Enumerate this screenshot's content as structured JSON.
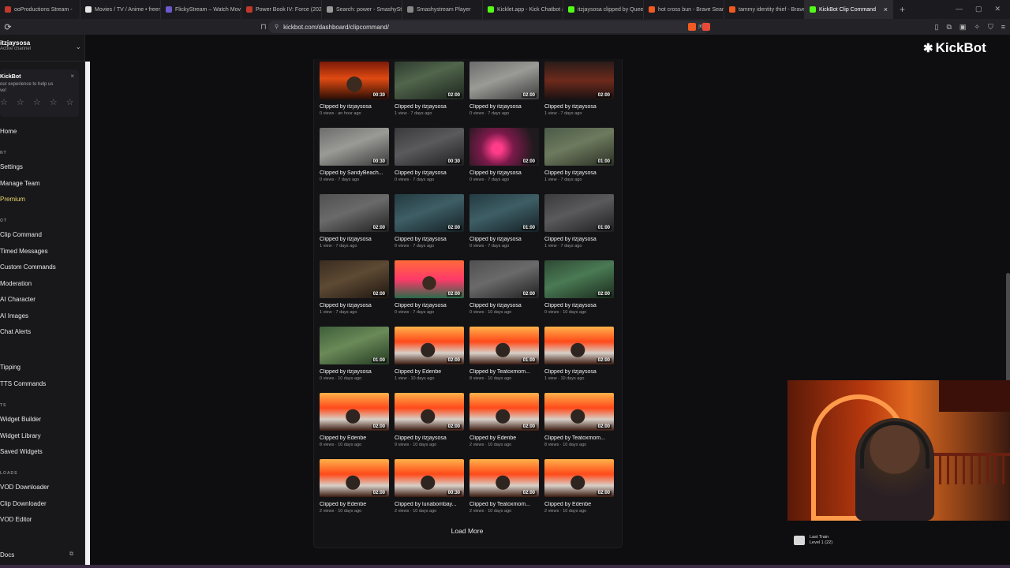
{
  "browser": {
    "tabs": [
      {
        "label": "ooProductions Stream - ",
        "fav": "#c0392b"
      },
      {
        "label": "Movies / TV / Anime • freemo...",
        "fav": "#e6e6e6"
      },
      {
        "label": "FlickyStream – Watch Movies &",
        "fav": "#6a5acd"
      },
      {
        "label": "Power Book IV: Force (2022) S...",
        "fav": "#c0392b"
      },
      {
        "label": "Search: power - SmashyStream",
        "fav": "#999999"
      },
      {
        "label": "Smashystream Player",
        "fav": "#888888"
      },
      {
        "label": "Kicklet.app - Kick Chatbot and",
        "fav": "#53fc18"
      },
      {
        "label": "itzjaysosa clipped by QueenH...",
        "fav": "#53fc18"
      },
      {
        "label": "hot cross bun - Brave Search",
        "fav": "#f15a22"
      },
      {
        "label": "tammy identity thief - Brave Se...",
        "fav": "#f15a22"
      },
      {
        "label": "KickBot Clip Command",
        "fav": "#53fc18",
        "active": true
      }
    ],
    "url": "kickbot.com/dashboard/clipcommand/"
  },
  "sidebar": {
    "channel_name": "itzjaysosa",
    "channel_status": "Active channel",
    "promo": {
      "title": "KickBot",
      "text_line1": "our experience to help us",
      "text_line2": "ve!",
      "stars": "☆ ☆ ☆ ☆ ☆",
      "close": "×"
    },
    "items": [
      {
        "label": "Home"
      },
      {
        "section": "NT"
      },
      {
        "label": "Settings"
      },
      {
        "label": "Manage Team"
      },
      {
        "label": "Premium"
      },
      {
        "section": "OT"
      },
      {
        "label": "Clip Command"
      },
      {
        "label": "Timed Messages"
      },
      {
        "label": "Custom Commands"
      },
      {
        "label": "Moderation"
      },
      {
        "label": "AI Character"
      },
      {
        "label": "AI Images"
      },
      {
        "label": "Chat Alerts"
      },
      {
        "label": "Tipping"
      },
      {
        "label": "TTS Commands"
      },
      {
        "section": "TS"
      },
      {
        "label": "Widget Builder"
      },
      {
        "label": "Widget Library"
      },
      {
        "label": "Saved Widgets"
      },
      {
        "section": "LOADS"
      },
      {
        "label": "VOD Downloader"
      },
      {
        "label": "Clip Downloader"
      },
      {
        "label": "VOD Editor"
      },
      {
        "label": "Docs"
      }
    ]
  },
  "logo": "KickBot",
  "clips": [
    {
      "title": "Clipped by itzjaysosa",
      "meta": "0 views · an hour ago",
      "duration": "00:30",
      "thumb": "fire"
    },
    {
      "title": "Clipped by itzjaysosa",
      "meta": "1 view · 7 days ago",
      "duration": "02:00",
      "thumb": "game-green"
    },
    {
      "title": "Clipped by itzjaysosa",
      "meta": "0 views · 7 days ago",
      "duration": "02:00",
      "thumb": "game-gray"
    },
    {
      "title": "Clipped by itzjaysosa",
      "meta": "1 view · 7 days ago",
      "duration": "02:00",
      "thumb": "stream"
    },
    {
      "title": "Clipped by SandyBeach...",
      "meta": "0 views · 7 days ago",
      "duration": "00:30",
      "thumb": "game-gray"
    },
    {
      "title": "Clipped by itzjaysosa",
      "meta": "0 views · 7 days ago",
      "duration": "00:30",
      "thumb": "dim"
    },
    {
      "title": "Clipped by itzjaysosa",
      "meta": "0 views · 7 days ago",
      "duration": "02:00",
      "thumb": "pink"
    },
    {
      "title": "Clipped by itzjaysosa",
      "meta": "1 view · 7 days ago",
      "duration": "01:00",
      "thumb": "pinkcity"
    },
    {
      "title": "Clipped by itzjaysosa",
      "meta": "1 view · 7 days ago",
      "duration": "02:00",
      "thumb": "dark"
    },
    {
      "title": "Clipped by itzjaysosa",
      "meta": "0 views · 7 days ago",
      "duration": "02:00",
      "thumb": "teal"
    },
    {
      "title": "Clipped by itzjaysosa",
      "meta": "0 views · 7 days ago",
      "duration": "01:00",
      "thumb": "teal"
    },
    {
      "title": "Clipped by itzjaysosa",
      "meta": "1 view · 7 days ago",
      "duration": "01:00",
      "thumb": "dim"
    },
    {
      "title": "Clipped by itzjaysosa",
      "meta": "1 view · 7 days ago",
      "duration": "02:00",
      "thumb": "brown"
    },
    {
      "title": "Clipped by itzjaysosa",
      "meta": "0 views · 7 days ago",
      "duration": "02:00",
      "thumb": "tropic"
    },
    {
      "title": "Clipped by itzjaysosa",
      "meta": "0 views · 10 days ago",
      "duration": "02:00",
      "thumb": "dark"
    },
    {
      "title": "Clipped by itzjaysosa",
      "meta": "0 views · 10 days ago",
      "duration": "02:00",
      "thumb": "car"
    },
    {
      "title": "Clipped by itzjaysosa",
      "meta": "0 views · 10 days ago",
      "duration": "01:00",
      "thumb": "jungle"
    },
    {
      "title": "Clipped by Edenbe",
      "meta": "1 view · 10 days ago",
      "duration": "02:00",
      "thumb": "flame2"
    },
    {
      "title": "Clipped by Teatoxmom...",
      "meta": "8 views · 10 days ago",
      "duration": "01:00",
      "thumb": "flame2"
    },
    {
      "title": "Clipped by itzjaysosa",
      "meta": "1 view · 10 days ago",
      "duration": "02:00",
      "thumb": "flame2"
    },
    {
      "title": "Clipped by Edenbe",
      "meta": "8 views · 10 days ago",
      "duration": "02:00",
      "thumb": "flame2"
    },
    {
      "title": "Clipped by itzjaysosa",
      "meta": "9 views · 10 days ago",
      "duration": "02:00",
      "thumb": "flame2"
    },
    {
      "title": "Clipped by Edenbe",
      "meta": "2 views · 10 days ago",
      "duration": "02:00",
      "thumb": "flame2"
    },
    {
      "title": "Clipped by Teatoxmom...",
      "meta": "8 views · 10 days ago",
      "duration": "02:00",
      "thumb": "flame2"
    },
    {
      "title": "Clipped by Edenbe",
      "meta": "2 views · 10 days ago",
      "duration": "02:00",
      "thumb": "flame2"
    },
    {
      "title": "Clipped by lunabombay...",
      "meta": "2 views · 10 days ago",
      "duration": "00:30",
      "thumb": "flame2"
    },
    {
      "title": "Clipped by Teatoxmom...",
      "meta": "2 views · 10 days ago",
      "duration": "02:00",
      "thumb": "flame2"
    },
    {
      "title": "Clipped by Edenbe",
      "meta": "2 views · 10 days ago",
      "duration": "02:00",
      "thumb": "flame2"
    }
  ],
  "load_more": "Load More",
  "now_playing": {
    "title": "Last Train",
    "subtitle": "Level 1  (22)"
  }
}
